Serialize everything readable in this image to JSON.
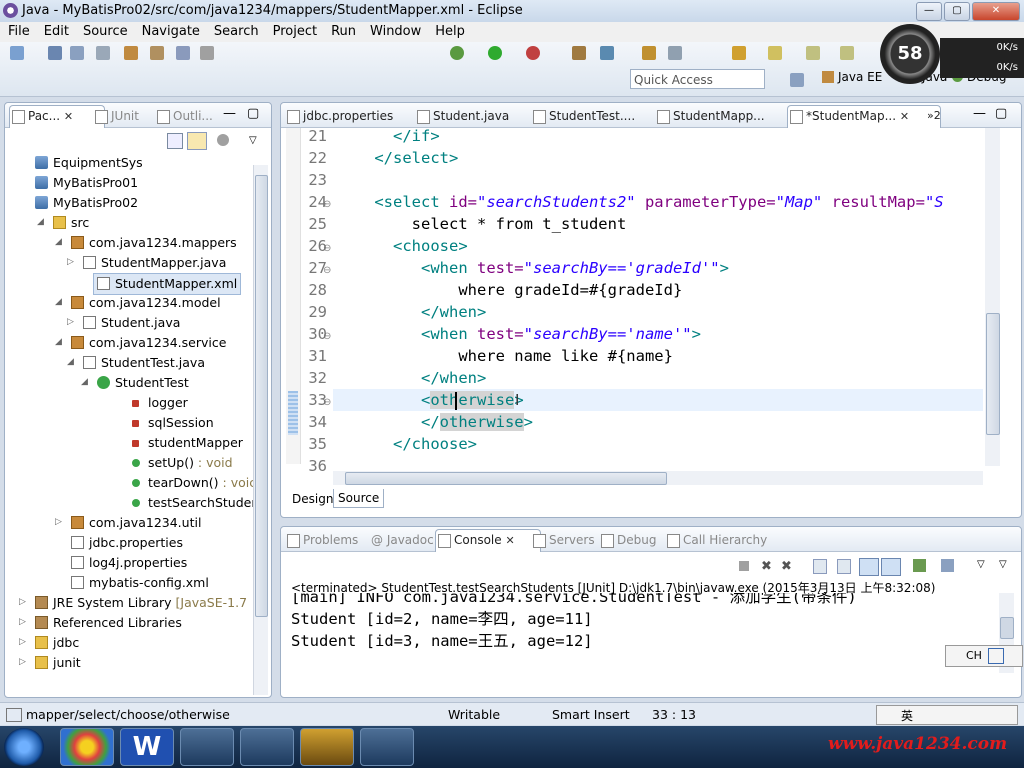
{
  "window": {
    "title": "Java - MyBatisPro02/src/com/java1234/mappers/StudentMapper.xml - Eclipse"
  },
  "menu": [
    "File",
    "Edit",
    "Source",
    "Navigate",
    "Search",
    "Project",
    "Run",
    "Window",
    "Help"
  ],
  "toolbar": {
    "quick_access": "Quick Access",
    "perspective_javaee": "Java EE",
    "perspective_java": "Java",
    "perspective_debug": "Debug",
    "gauge": "58",
    "net_up": "0K/s",
    "net_down": "0K/s"
  },
  "left_tabs": {
    "package_explorer": "Pac...",
    "junit": "JUnit",
    "outline": "Outli..."
  },
  "tree": [
    {
      "label": "EquipmentSys",
      "icon": "project"
    },
    {
      "label": "MyBatisPro01",
      "icon": "project"
    },
    {
      "label": "MyBatisPro02",
      "icon": "project"
    },
    {
      "label": "src",
      "icon": "folder"
    },
    {
      "label": "com.java1234.mappers",
      "icon": "package"
    },
    {
      "label": "StudentMapper.java",
      "icon": "java"
    },
    {
      "label": "StudentMapper.xml",
      "icon": "xml"
    },
    {
      "label": "com.java1234.model",
      "icon": "package"
    },
    {
      "label": "Student.java",
      "icon": "java"
    },
    {
      "label": "com.java1234.service",
      "icon": "package"
    },
    {
      "label": "StudentTest.java",
      "icon": "java"
    },
    {
      "label": "StudentTest",
      "icon": "class"
    },
    {
      "label": "logger",
      "icon": "field"
    },
    {
      "label": "sqlSession",
      "icon": "field"
    },
    {
      "label": "studentMapper",
      "icon": "field"
    },
    {
      "label": "setUp()",
      "suffix": " : void",
      "icon": "method"
    },
    {
      "label": "tearDown()",
      "suffix": " : voic",
      "icon": "method"
    },
    {
      "label": "testSearchStuder",
      "icon": "method"
    },
    {
      "label": "com.java1234.util",
      "icon": "package"
    },
    {
      "label": "jdbc.properties",
      "icon": "file"
    },
    {
      "label": "log4j.properties",
      "icon": "file"
    },
    {
      "label": "mybatis-config.xml",
      "icon": "xml"
    },
    {
      "label": "JRE System Library",
      "suffix": " [JavaSE-1.7",
      "icon": "library"
    },
    {
      "label": "Referenced Libraries",
      "icon": "library"
    },
    {
      "label": "jdbc",
      "icon": "folder"
    },
    {
      "label": "junit",
      "icon": "folder"
    }
  ],
  "editor_tabs": [
    "jdbc.properties",
    "Student.java",
    "StudentTest....",
    "StudentMapp...",
    "*StudentMap..."
  ],
  "editor_tab_overflow": "»2",
  "code": [
    {
      "n": "21",
      "parts": [
        [
          "t",
          "      </if>"
        ]
      ]
    },
    {
      "n": "22",
      "parts": [
        [
          "t",
          "    </select>"
        ]
      ]
    },
    {
      "n": "23",
      "parts": []
    },
    {
      "n": "24",
      "parts": [
        [
          "t",
          "    <select "
        ],
        [
          "a",
          "id="
        ],
        [
          "v",
          "\"searchStudents2\""
        ],
        [
          "a",
          " parameterType="
        ],
        [
          "v",
          "\"Map\""
        ],
        [
          "a",
          " resultMap="
        ],
        [
          "v",
          "\"S"
        ]
      ]
    },
    {
      "n": "25",
      "parts": [
        [
          "p",
          "        select * from t_student"
        ]
      ]
    },
    {
      "n": "26",
      "parts": [
        [
          "t",
          "      <choose>"
        ]
      ]
    },
    {
      "n": "27",
      "parts": [
        [
          "t",
          "         <when "
        ],
        [
          "a",
          "test="
        ],
        [
          "v",
          "\"searchBy=='gradeId'\""
        ],
        [
          "t",
          ">"
        ]
      ]
    },
    {
      "n": "28",
      "parts": [
        [
          "p",
          "             where gradeId=#{gradeId}"
        ]
      ]
    },
    {
      "n": "29",
      "parts": [
        [
          "t",
          "         </when>"
        ]
      ]
    },
    {
      "n": "30",
      "parts": [
        [
          "t",
          "         <when "
        ],
        [
          "a",
          "test="
        ],
        [
          "v",
          "\"searchBy=='name'\""
        ],
        [
          "t",
          ">"
        ]
      ]
    },
    {
      "n": "31",
      "parts": [
        [
          "p",
          "             where name like #{name}"
        ]
      ]
    },
    {
      "n": "32",
      "parts": [
        [
          "t",
          "         </when>"
        ]
      ]
    },
    {
      "n": "33",
      "parts": [
        [
          "t",
          "         <"
        ],
        [
          "h",
          "otherwise"
        ],
        [
          "t",
          ">"
        ]
      ]
    },
    {
      "n": "34",
      "parts": [
        [
          "t",
          "         </"
        ],
        [
          "h",
          "otherwise"
        ],
        [
          "t",
          ">"
        ]
      ]
    },
    {
      "n": "35",
      "parts": [
        [
          "t",
          "      </choose>"
        ]
      ]
    },
    {
      "n": "36",
      "parts": []
    }
  ],
  "editor_bottom_tabs": {
    "design": "Design",
    "source": "Source"
  },
  "console_tabs": [
    "Problems",
    "@ Javadoc",
    "Console",
    "Servers",
    "Debug",
    "Call Hierarchy"
  ],
  "console": {
    "header": "<terminated> StudentTest.testSearchStudents [JUnit] D:\\jdk1.7\\bin\\javaw.exe (2015年3月13日 上午8:32:08)",
    "lines": [
      "[main] INFO com.java1234.service.StudentTest - 添加学生(带条件)",
      "Student [id=2, name=李四, age=11]",
      "Student [id=3, name=王五, age=12]"
    ]
  },
  "status": {
    "path": "mapper/select/choose/otherwise",
    "writable": "Writable",
    "insert": "Smart Insert",
    "position": "33 : 13"
  },
  "ime": {
    "lang": "CH",
    "mode": "英"
  },
  "watermark": "www.java1234.com",
  "colors": {
    "tag": "#008080",
    "attr": "#7f007f",
    "value": "#2a00ff",
    "watermark": "#e21c1c"
  }
}
